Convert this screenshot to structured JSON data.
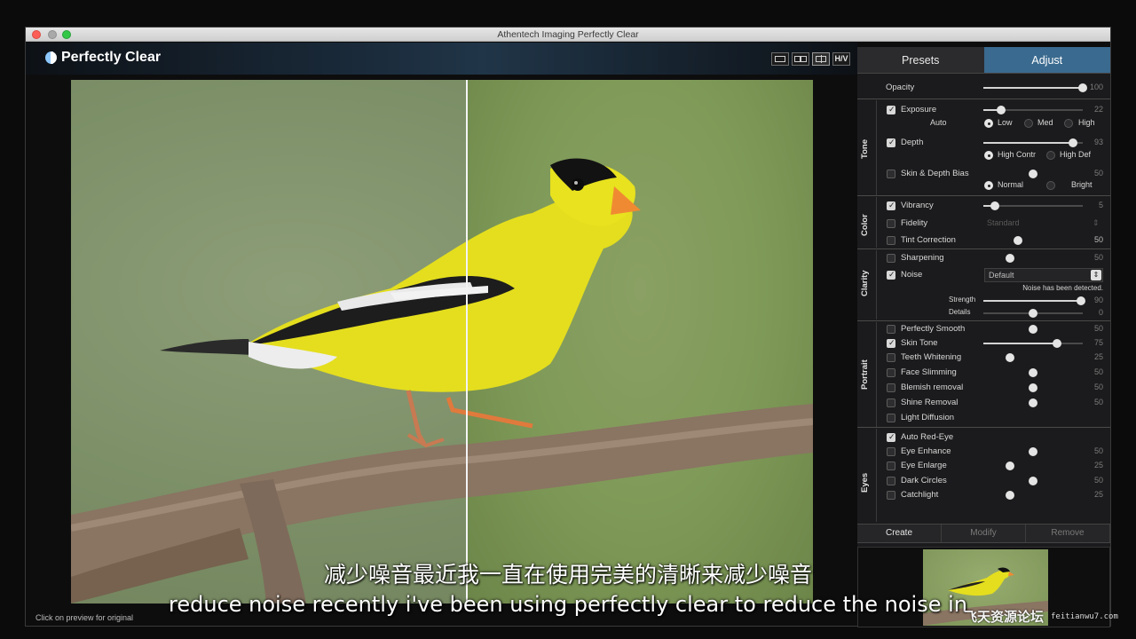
{
  "window": {
    "title": "Athentech Imaging Perfectly Clear"
  },
  "app": {
    "logo_text": "Perfectly Clear",
    "view_buttons": [
      "single-view",
      "side-by-side",
      "split-view",
      "H/V"
    ],
    "hv_label": "H/V"
  },
  "preview": {
    "hint": "Click on preview for original",
    "split_position": 0.533
  },
  "panel": {
    "tabs": [
      {
        "label": "Presets"
      },
      {
        "label": "Adjust"
      }
    ],
    "opacity": {
      "label": "Opacity",
      "value": "100",
      "level": 1.0
    },
    "sections": {
      "tone": "Tone",
      "color": "Color",
      "clarity": "Clarity",
      "portrait": "Portrait",
      "eyes": "Eyes"
    },
    "exposure": {
      "label": "Exposure",
      "value": "22",
      "level": 0.18,
      "checked": true,
      "auto_label": "Auto",
      "options": [
        "Low",
        "Med",
        "High"
      ],
      "selected": "Low"
    },
    "depth": {
      "label": "Depth",
      "value": "93",
      "level": 0.9,
      "checked": true,
      "options": [
        "High Contr",
        "High Def"
      ],
      "selected": "High Contr"
    },
    "skin_depth_bias": {
      "label": "Skin & Depth Bias",
      "value": "50",
      "level": 0.5,
      "checked": false,
      "options": [
        "Normal",
        "Bright"
      ],
      "selected": "Normal"
    },
    "vibrancy": {
      "label": "Vibrancy",
      "value": "5",
      "level": 0.12,
      "checked": true
    },
    "fidelity": {
      "label": "Fidelity",
      "value": "Standard",
      "checked": false
    },
    "tint_correction": {
      "label": "Tint Correction",
      "value": "50",
      "level": 0.35,
      "checked": false
    },
    "sharpening": {
      "label": "Sharpening",
      "value": "50",
      "level": 0.27,
      "checked": false
    },
    "noise": {
      "label": "Noise",
      "checked": true,
      "preset": "Default",
      "note": "Noise has been detected.",
      "strength_label": "Strength",
      "strength_value": "90",
      "strength_level": 0.98,
      "details_label": "Details",
      "details_value": "0",
      "details_level": 0.5
    },
    "perfectly_smooth": {
      "label": "Perfectly Smooth",
      "value": "50",
      "level": 0.5,
      "checked": false
    },
    "skin_tone": {
      "label": "Skin Tone",
      "value": "75",
      "level": 0.74,
      "checked": true
    },
    "teeth_whitening": {
      "label": "Teeth Whitening",
      "value": "25",
      "level": 0.27,
      "checked": false
    },
    "face_slimming": {
      "label": "Face Slimming",
      "value": "50",
      "level": 0.5,
      "checked": false
    },
    "blemish_removal": {
      "label": "Blemish removal",
      "value": "50",
      "level": 0.5,
      "checked": false
    },
    "shine_removal": {
      "label": "Shine Removal",
      "value": "50",
      "level": 0.5,
      "checked": false
    },
    "light_diffusion": {
      "label": "Light Diffusion",
      "checked": false
    },
    "auto_red_eye": {
      "label": "Auto Red-Eye",
      "checked": true
    },
    "eye_enhance": {
      "label": "Eye Enhance",
      "value": "50",
      "level": 0.5,
      "checked": false
    },
    "eye_enlarge": {
      "label": "Eye Enlarge",
      "value": "25",
      "level": 0.27,
      "checked": false
    },
    "dark_circles": {
      "label": "Dark Circles",
      "value": "50",
      "level": 0.5,
      "checked": false
    },
    "catchlight": {
      "label": "Catchlight",
      "value": "25",
      "level": 0.27,
      "checked": false
    },
    "actions": [
      "Create",
      "Modify",
      "Remove"
    ]
  },
  "subtitles": {
    "zh": "减少噪音最近我一直在使用完美的清晰来减少噪音",
    "en": "reduce noise recently i've been using perfectly clear to reduce the noise in"
  },
  "watermark": {
    "site": "飞天资源论坛",
    "url": "feitianwu7.com"
  }
}
